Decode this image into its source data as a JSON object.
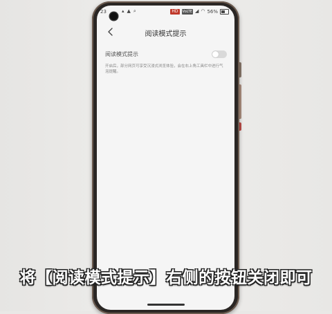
{
  "statusbar": {
    "time": "23",
    "left_icons": [
      "notification-icon",
      "alert-icon",
      "search-icon"
    ],
    "hd": "HD",
    "volte": "VoLTE",
    "battery_percent": "56%"
  },
  "header": {
    "title": "阅读模式提示",
    "back_icon": "chevron-left-icon"
  },
  "setting": {
    "label": "阅读模式提示",
    "enabled": false,
    "description": "开启后，部分网页可享受沉浸式浏览体验，会在右上角工具栏中进行气泡提醒。"
  },
  "caption": {
    "text": "将【阅读模式提示】右侧的按钮关闭即可"
  },
  "colors": {
    "screen_bg": "#f5f5f5",
    "toggle_off": "#d9d9d9",
    "phone_frame": "#2a2624",
    "caption_text": "#ffffff"
  }
}
